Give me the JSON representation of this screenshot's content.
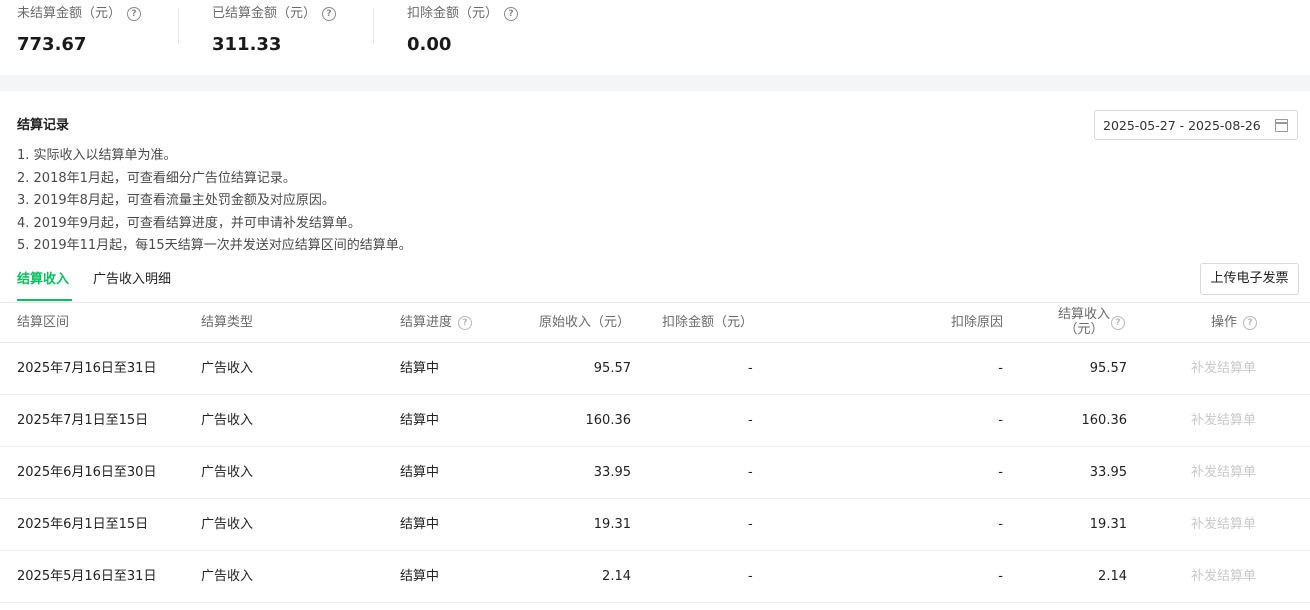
{
  "summary": {
    "unsettled": {
      "label": "未结算金额（元）",
      "value": "773.67"
    },
    "settled": {
      "label": "已结算金额（元）",
      "value": "311.33"
    },
    "deducted": {
      "label": "扣除金额（元）",
      "value": "0.00"
    }
  },
  "records": {
    "title": "结算记录",
    "date_range": "2025-05-27 - 2025-08-26",
    "notes": [
      "1. 实际收入以结算单为准。",
      "2. 2018年1月起，可查看细分广告位结算记录。",
      "3. 2019年8月起，可查看流量主处罚金额及对应原因。",
      "4. 2019年9月起，可查看结算进度，并可申请补发结算单。",
      "5. 2019年11月起，每15天结算一次并发送对应结算区间的结算单。"
    ],
    "tabs": [
      "结算收入",
      "广告收入明细"
    ],
    "upload_label": "上传电子发票"
  },
  "table": {
    "headers": {
      "period": "结算区间",
      "type": "结算类型",
      "progress": "结算进度",
      "original": "原始收入（元）",
      "deduct_amount": "扣除金额（元）",
      "deduct_reason": "扣除原因",
      "settle_income_1": "结算收入",
      "settle_income_2": "（元）",
      "action": "操作"
    },
    "rows": [
      {
        "period": "2025年7月16日至31日",
        "type": "广告收入",
        "progress": "结算中",
        "original": "95.57",
        "deduct_amount": "-",
        "deduct_reason": "-",
        "settle_income": "95.57",
        "action": "补发结算单"
      },
      {
        "period": "2025年7月1日至15日",
        "type": "广告收入",
        "progress": "结算中",
        "original": "160.36",
        "deduct_amount": "-",
        "deduct_reason": "-",
        "settle_income": "160.36",
        "action": "补发结算单"
      },
      {
        "period": "2025年6月16日至30日",
        "type": "广告收入",
        "progress": "结算中",
        "original": "33.95",
        "deduct_amount": "-",
        "deduct_reason": "-",
        "settle_income": "33.95",
        "action": "补发结算单"
      },
      {
        "period": "2025年6月1日至15日",
        "type": "广告收入",
        "progress": "结算中",
        "original": "19.31",
        "deduct_amount": "-",
        "deduct_reason": "-",
        "settle_income": "19.31",
        "action": "补发结算单"
      },
      {
        "period": "2025年5月16日至31日",
        "type": "广告收入",
        "progress": "结算中",
        "original": "2.14",
        "deduct_amount": "-",
        "deduct_reason": "-",
        "settle_income": "2.14",
        "action": "补发结算单"
      }
    ]
  },
  "colors": {
    "accent": "#07c160",
    "disabled_text": "#c9c9c9"
  }
}
